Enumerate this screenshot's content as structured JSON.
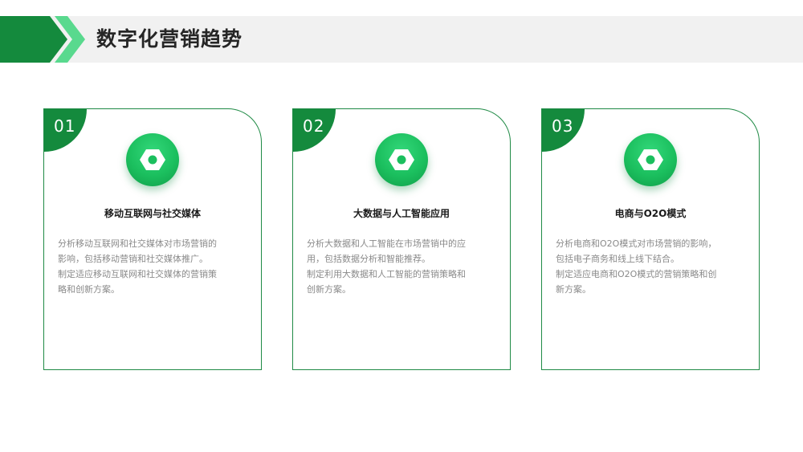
{
  "header": {
    "title": "数字化营销趋势"
  },
  "colors": {
    "primary": "#148a3d",
    "accent": "#59d98e",
    "header_bg": "#f1f1f1"
  },
  "cards": [
    {
      "number": "01",
      "icon": "hex-nut-icon",
      "title": "移动互联网与社交媒体",
      "description": "分析移动互联网和社交媒体对市场营销的\n影响，包括移动营销和社交媒体推广。\n制定适应移动互联网和社交媒体的营销策\n略和创新方案。"
    },
    {
      "number": "02",
      "icon": "hex-nut-icon",
      "title": "大数据与人工智能应用",
      "description": "分析大数据和人工智能在市场营销中的应\n用，包括数据分析和智能推荐。\n制定利用大数据和人工智能的营销策略和\n创新方案。"
    },
    {
      "number": "03",
      "icon": "hex-nut-icon",
      "title": "电商与O2O模式",
      "description": "分析电商和O2O模式对市场营销的影响，\n包括电子商务和线上线下结合。\n制定适应电商和O2O模式的营销策略和创\n新方案。"
    }
  ]
}
